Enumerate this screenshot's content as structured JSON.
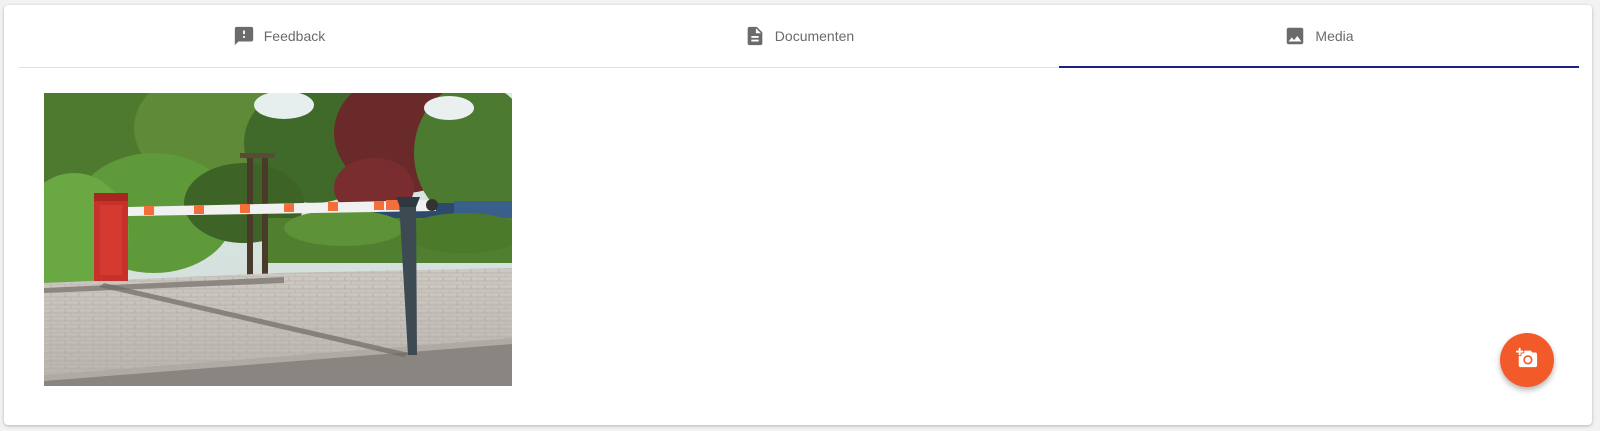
{
  "tabs": [
    {
      "label": "Feedback",
      "icon": "feedback-icon",
      "active": false
    },
    {
      "label": "Documenten",
      "icon": "document-icon",
      "active": false
    },
    {
      "label": "Media",
      "icon": "image-icon",
      "active": true
    }
  ],
  "media": {
    "items": [
      {
        "type": "image",
        "subject": "parking barrier gate"
      }
    ]
  },
  "fab": {
    "icon": "add-photo-icon"
  },
  "colors": {
    "active_tab_indicator": "#1a237e",
    "fab_background": "#f25a2a",
    "tab_icon": "#6b6b6b",
    "tab_text": "#6b6b6b"
  }
}
